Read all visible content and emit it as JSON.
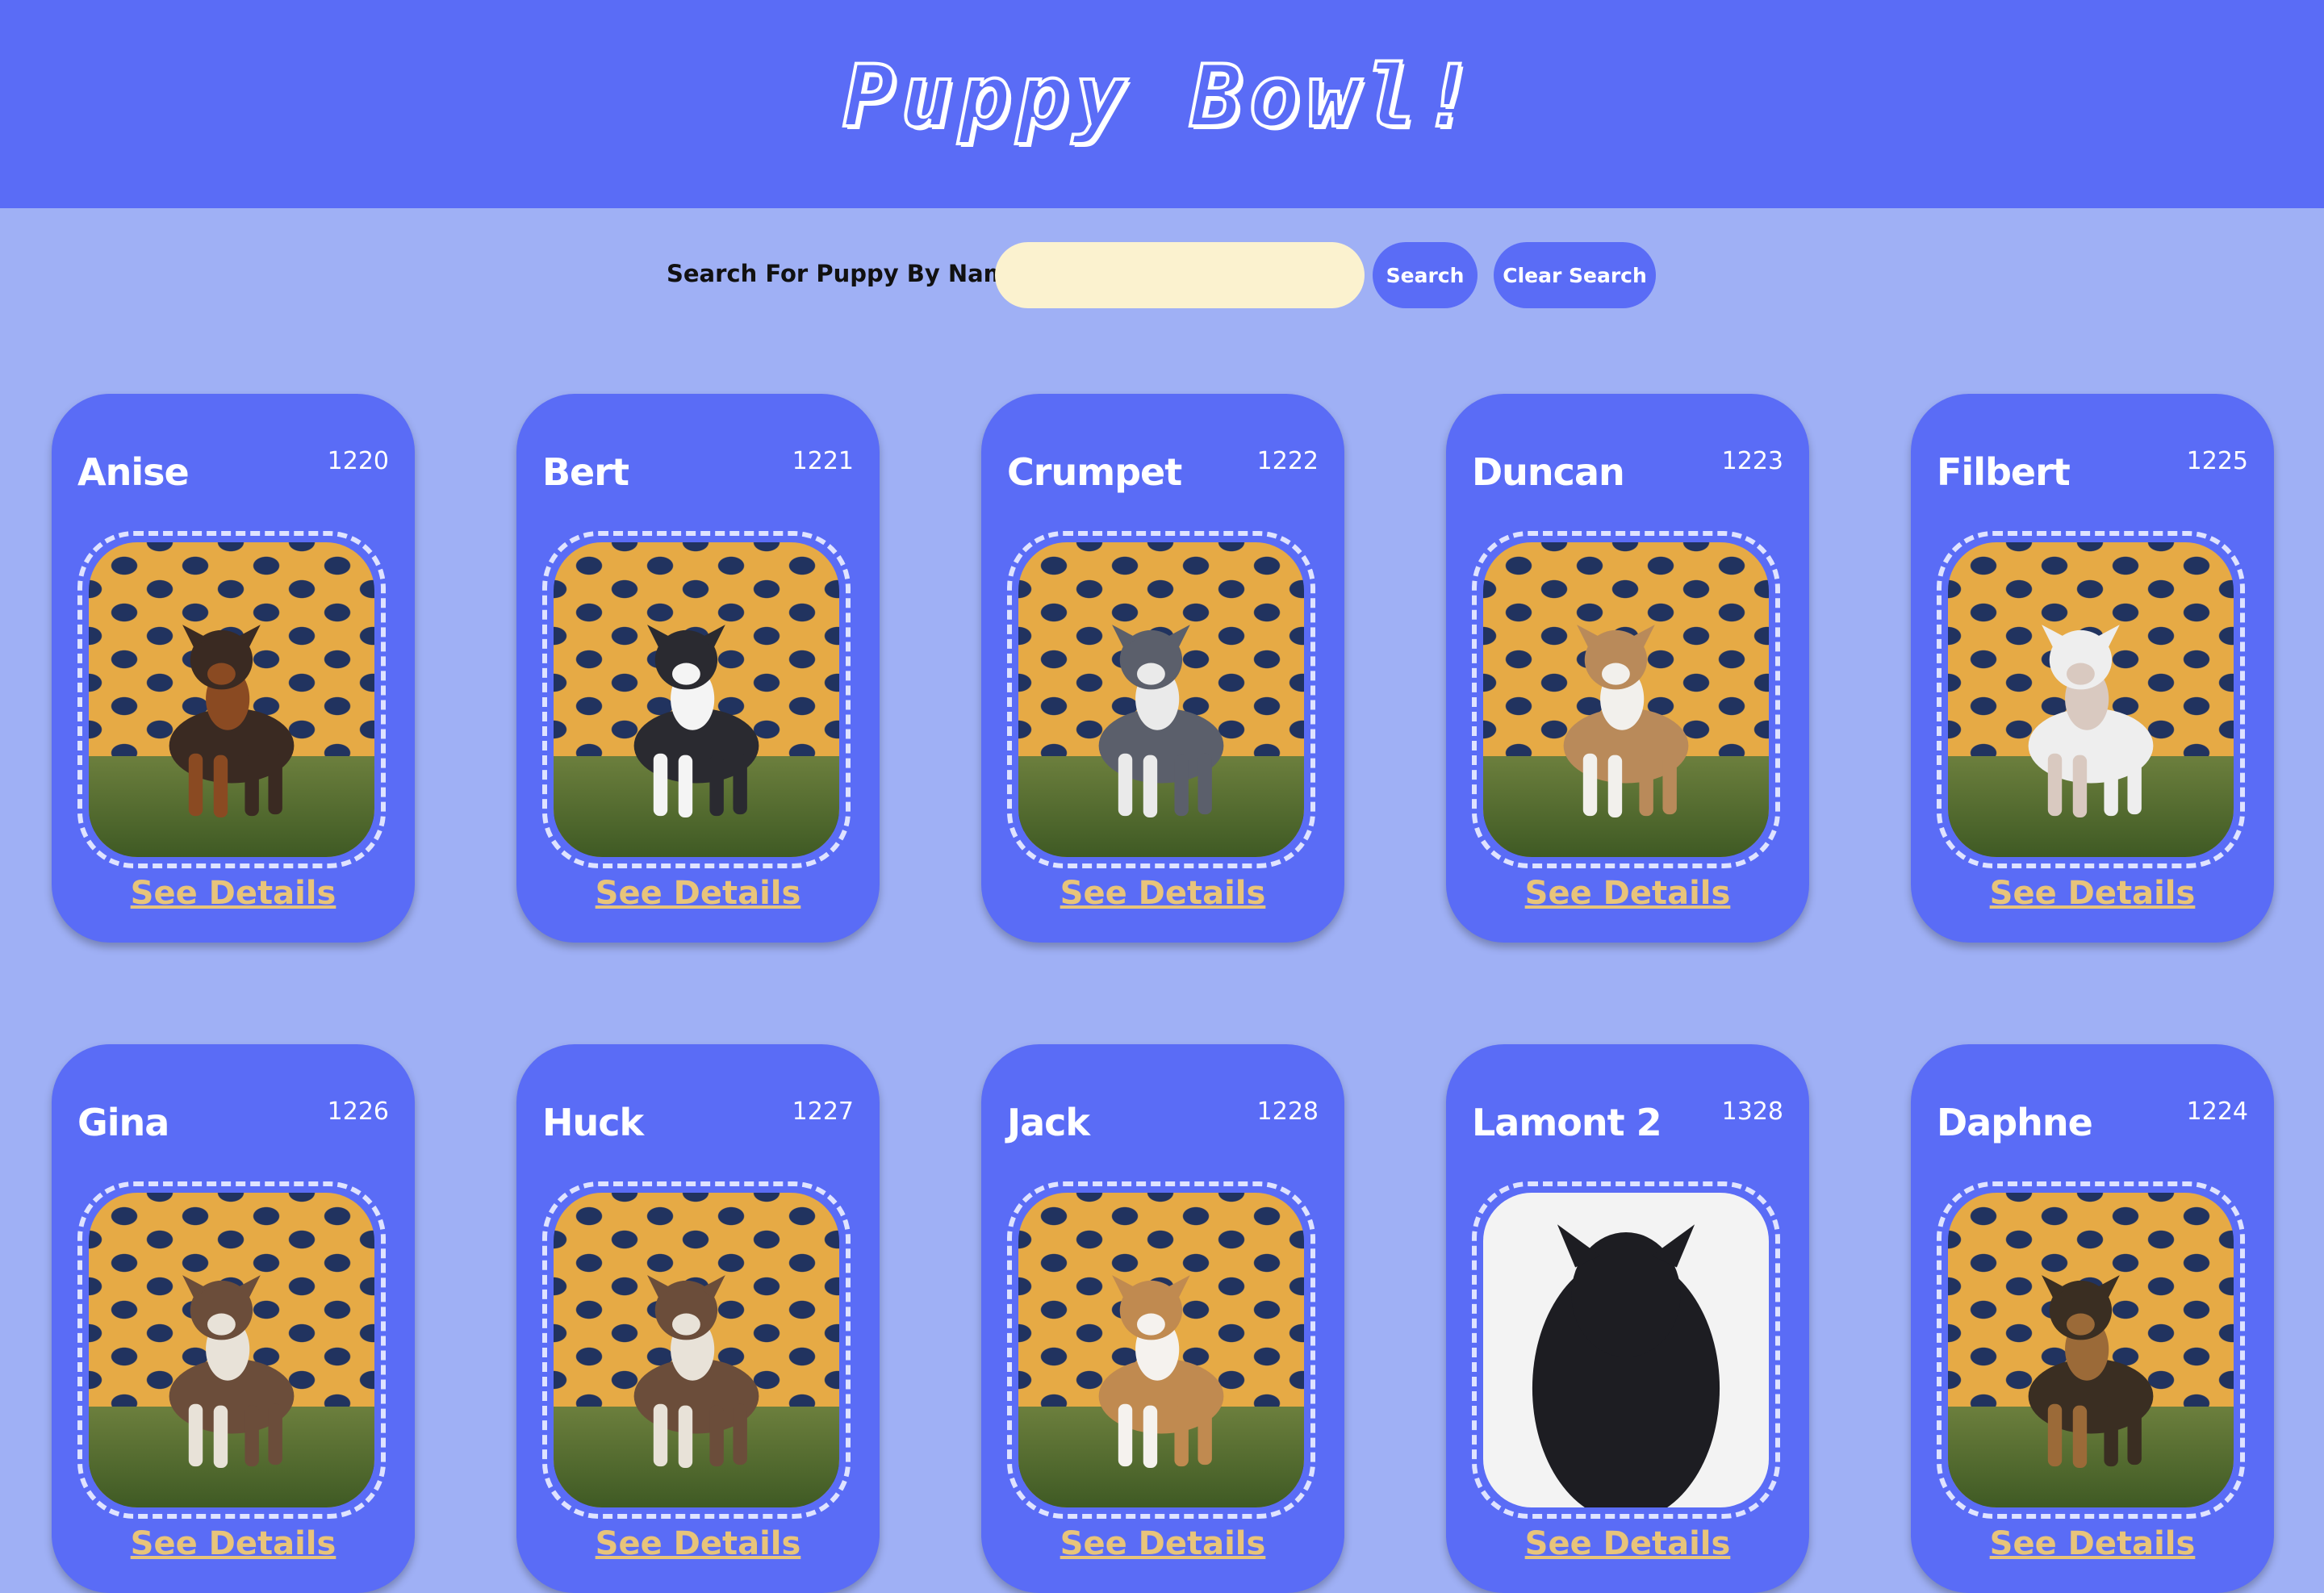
{
  "header": {
    "title": "Puppy Bowl!"
  },
  "search": {
    "label": "Search For Puppy By Name:",
    "value": "",
    "search_button": "Search",
    "clear_button": "Clear Search"
  },
  "colors": {
    "background": "#9fb0f5",
    "primary": "#5a6cf6",
    "input_bg": "#fbf2cf",
    "details_link": "#e8c47a"
  },
  "puppies": [
    {
      "name": "Anise",
      "id": "1220",
      "link": "See Details",
      "photo": "dog-brown-black"
    },
    {
      "name": "Bert",
      "id": "1221",
      "link": "See Details",
      "photo": "dog-black-white"
    },
    {
      "name": "Crumpet",
      "id": "1222",
      "link": "See Details",
      "photo": "dog-gray-sitting"
    },
    {
      "name": "Duncan",
      "id": "1223",
      "link": "See Details",
      "photo": "dog-sable-white"
    },
    {
      "name": "Filbert",
      "id": "1225",
      "link": "See Details",
      "photo": "dog-white-sitting"
    },
    {
      "name": "Gina",
      "id": "1226",
      "link": "See Details",
      "photo": "dog-photo"
    },
    {
      "name": "Huck",
      "id": "1227",
      "link": "See Details",
      "photo": "dog-photo"
    },
    {
      "name": "Jack",
      "id": "1228",
      "link": "See Details",
      "photo": "dog-tan-white"
    },
    {
      "name": "Lamont 2",
      "id": "1328",
      "link": "See Details",
      "photo": "dog-black-white-bg"
    },
    {
      "name": "Daphne",
      "id": "1224",
      "link": "See Details",
      "photo": "dog-shepherd"
    }
  ]
}
